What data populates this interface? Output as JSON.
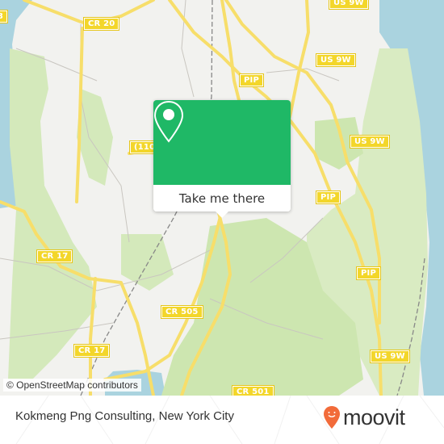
{
  "map": {
    "attribution": "© OpenStreetMap contributors",
    "road_shields": [
      {
        "id": "cr20",
        "label": "CR 20"
      },
      {
        "id": "us9w-top",
        "label": "US 9W"
      },
      {
        "id": "us9w-1",
        "label": "US 9W"
      },
      {
        "id": "pip-1",
        "label": "PIP"
      },
      {
        "id": "us9w-2",
        "label": "US 9W"
      },
      {
        "id": "r110",
        "label": "(110"
      },
      {
        "id": "pip-2",
        "label": "PIP"
      },
      {
        "id": "cr17-1",
        "label": "CR 17"
      },
      {
        "id": "pip-3",
        "label": "PIP"
      },
      {
        "id": "cr505",
        "label": "CR 505"
      },
      {
        "id": "cr17-2",
        "label": "CR 17"
      },
      {
        "id": "us9w-3",
        "label": "US 9W"
      },
      {
        "id": "cr501",
        "label": "CR 501"
      },
      {
        "id": "edge-3",
        "label": "3"
      }
    ],
    "colors": {
      "land": "#f2f2ef",
      "water": "#aad3df",
      "park": "#cde6b0",
      "road": "#f7de6a",
      "shield": "#f3d62a"
    }
  },
  "popup": {
    "icon": "location-pin-icon",
    "button_label": "Take me there",
    "color": "#1fb866"
  },
  "footer": {
    "place_name": "Kokmeng Png Consulting, New York City",
    "brand": "moovit",
    "brand_color": "#f26b3a"
  }
}
